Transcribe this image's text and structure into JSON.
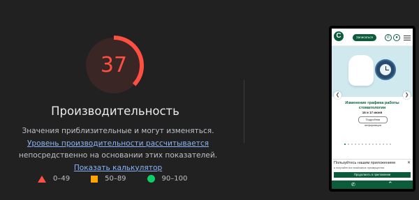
{
  "score": {
    "value": "37",
    "fraction": 0.37,
    "color": "#ff4e42",
    "track_color": "#4a2a26"
  },
  "title": "Производительность",
  "description": {
    "text1": "Значения приблизительные и могут изменяться. ",
    "link1": "Уровень производительности рассчитывается",
    "text2": " непосредственно на основании этих показателей. ",
    "link2": "Показать калькулятор"
  },
  "legend": {
    "poor": "0–49",
    "average": "50–89",
    "good": "90–100",
    "colors": {
      "poor": "#ff4e42",
      "average": "#ffa400",
      "good": "#0cce6b"
    }
  },
  "screenshot": {
    "book_button": "Записаться",
    "slide_title": "Изменение графика работы стоматологии",
    "slide_subtitle": "16 и 17 июня",
    "more_button": "Подробная информация",
    "app_banner_title": "Пользуйтесь нашим приложением",
    "app_banner_desc": "и получайте все возможные преимущества",
    "app_banner_button": "Продолжить в приложении",
    "brand_color": "#0a5c3a"
  }
}
